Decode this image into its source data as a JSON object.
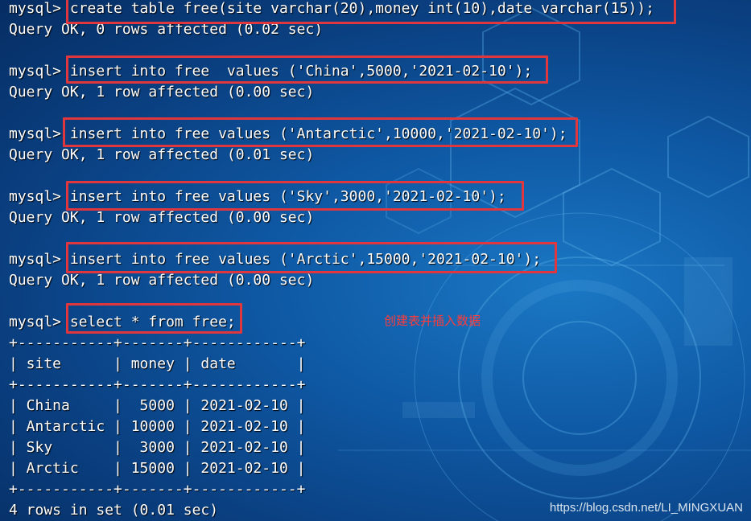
{
  "terminal": {
    "lines": [
      {
        "prompt": "mysql> ",
        "cmd": "create table free(site varchar(20),money int(10),date varchar(15));"
      },
      {
        "text": "Query OK, 0 rows affected (0.02 sec)"
      },
      {
        "text": ""
      },
      {
        "prompt": "mysql> ",
        "cmd": "insert into free  values ('China',5000,'2021-02-10');"
      },
      {
        "text": "Query OK, 1 row affected (0.00 sec)"
      },
      {
        "text": ""
      },
      {
        "prompt": "mysql> ",
        "cmd": "insert into free values ('Antarctic',10000,'2021-02-10');"
      },
      {
        "text": "Query OK, 1 row affected (0.01 sec)"
      },
      {
        "text": ""
      },
      {
        "prompt": "mysql> ",
        "cmd": "insert into free values ('Sky',3000,'2021-02-10');"
      },
      {
        "text": "Query OK, 1 row affected (0.00 sec)"
      },
      {
        "text": ""
      },
      {
        "prompt": "mysql> ",
        "cmd": "insert into free values ('Arctic',15000,'2021-02-10');"
      },
      {
        "text": "Query OK, 1 row affected (0.00 sec)"
      },
      {
        "text": ""
      },
      {
        "prompt": "mysql> ",
        "cmd": "select * from free;"
      },
      {
        "text": "+-----------+-------+------------+"
      },
      {
        "text": "| site      | money | date       |"
      },
      {
        "text": "+-----------+-------+------------+"
      },
      {
        "text": "| China     |  5000 | 2021-02-10 |"
      },
      {
        "text": "| Antarctic | 10000 | 2021-02-10 |"
      },
      {
        "text": "| Sky       |  3000 | 2021-02-10 |"
      },
      {
        "text": "| Arctic    | 15000 | 2021-02-10 |"
      },
      {
        "text": "+-----------+-------+------------+"
      },
      {
        "text": "4 rows in set (0.01 sec)"
      }
    ],
    "table": {
      "columns": [
        "site",
        "money",
        "date"
      ],
      "rows": [
        [
          "China",
          "5000",
          "2021-02-10"
        ],
        [
          "Antarctic",
          "10000",
          "2021-02-10"
        ],
        [
          "Sky",
          "3000",
          "2021-02-10"
        ],
        [
          "Arctic",
          "15000",
          "2021-02-10"
        ]
      ]
    }
  },
  "annotation": "创建表并插入数据",
  "watermark": "https://blog.csdn.net/LI_MINGXUAN",
  "colors": {
    "text": "#ffffff",
    "highlight_border": "#e0363d",
    "annotation": "#ff3b3b",
    "background": "#0f5aa6"
  }
}
